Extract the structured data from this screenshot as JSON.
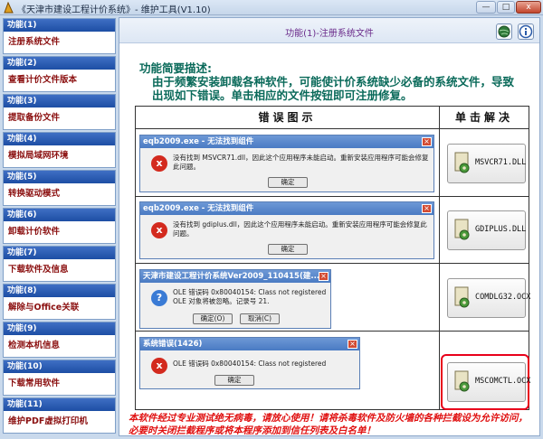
{
  "window": {
    "title": "《天津市建设工程计价系统》- 维护工具(V1.10)",
    "min_label": "—",
    "max_label": "□",
    "close_label": "x"
  },
  "sidebar": {
    "items": [
      {
        "head": "功能(1)",
        "label": "注册系统文件"
      },
      {
        "head": "功能(2)",
        "label": "查看计价文件版本"
      },
      {
        "head": "功能(3)",
        "label": "提取备份文件"
      },
      {
        "head": "功能(4)",
        "label": "模拟局域网环境"
      },
      {
        "head": "功能(5)",
        "label": "转换驱动模式"
      },
      {
        "head": "功能(6)",
        "label": "卸载计价软件"
      },
      {
        "head": "功能(7)",
        "label": "下载软件及信息"
      },
      {
        "head": "功能(8)",
        "label": "解除与Office关联"
      },
      {
        "head": "功能(9)",
        "label": "检测本机信息"
      },
      {
        "head": "功能(10)",
        "label": "下载常用软件"
      },
      {
        "head": "功能(11)",
        "label": "维护PDF虚拟打印机"
      }
    ]
  },
  "main": {
    "title": "功能(1)-注册系统文件",
    "desc_title": "功能简要描述:",
    "desc_body": "由于频繁安装卸载各种软件，可能使计价系统缺少必备的系统文件，导致出现如下错误。单击相应的文件按钮即可注册修复。",
    "col_errors": "错误图示",
    "col_fix": "单击解决",
    "rows": [
      {
        "dlg_title": "eqb2009.exe - 无法找到组件",
        "icon": "x",
        "msg": "没有找到 MSVCR71.dll，因此这个应用程序未能启动。重新安装应用程序可能会修复此问题。",
        "ok": "确定",
        "cancel": "",
        "fix": "MSVCR71.DLL"
      },
      {
        "dlg_title": "eqb2009.exe - 无法找到组件",
        "icon": "x",
        "msg": "没有找到 gdiplus.dll，因此这个应用程序未能启动。重新安装应用程序可能会修复此问题。",
        "ok": "确定",
        "cancel": "",
        "fix": "GDIPLUS.DLL"
      },
      {
        "dlg_title": "天津市建设工程计价系统Ver2009_110415(建...",
        "icon": "?",
        "msg": "OLE 错误码 0x80040154: Class not registered  OLE 对象将被忽略。记录号 21.",
        "ok": "确定(O)",
        "cancel": "取消(C)",
        "fix": "COMDLG32.OCX"
      },
      {
        "dlg_title": "系统错误(1426)",
        "icon": "x",
        "msg": "OLE 错误码 0x80040154: Class not registered",
        "ok": "确定",
        "cancel": "",
        "fix": "MSCOMCTL.OCX"
      }
    ]
  },
  "footer": "本软件经过专业测试绝无病毒，请放心使用！请将杀毒软件及防火墙的各种拦截设为允许访问，必要时关闭拦截程序或将本程序添加到信任列表及白名单！",
  "colors": {
    "accent": "#1d4ea4",
    "warn": "#e01010",
    "highlight": "#e8001a"
  }
}
